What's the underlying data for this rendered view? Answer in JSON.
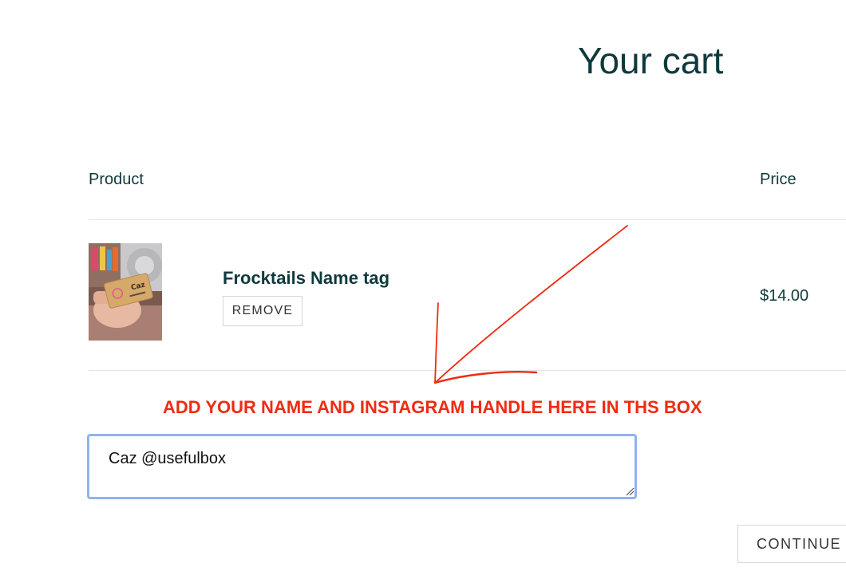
{
  "page": {
    "title": "Your cart"
  },
  "cart": {
    "columns": {
      "product": "Product",
      "price": "Price"
    },
    "items": [
      {
        "name": "Frocktails Name tag",
        "remove_label": "REMOVE",
        "price": "$14.00",
        "image_icon": "product-photo-wooden-name-tag",
        "image_tag_text": "Caz"
      }
    ]
  },
  "annotation": {
    "text": "ADD YOUR NAME AND INSTAGRAM HANDLE HERE IN THS BOX",
    "color": "#ee2b12"
  },
  "note": {
    "value": "Caz @usefulbox"
  },
  "actions": {
    "continue_label": "CONTINUE S"
  },
  "colors": {
    "heading": "#0f3a3d",
    "focus_border": "#8fb3ee",
    "annotation": "#ee2b12"
  }
}
